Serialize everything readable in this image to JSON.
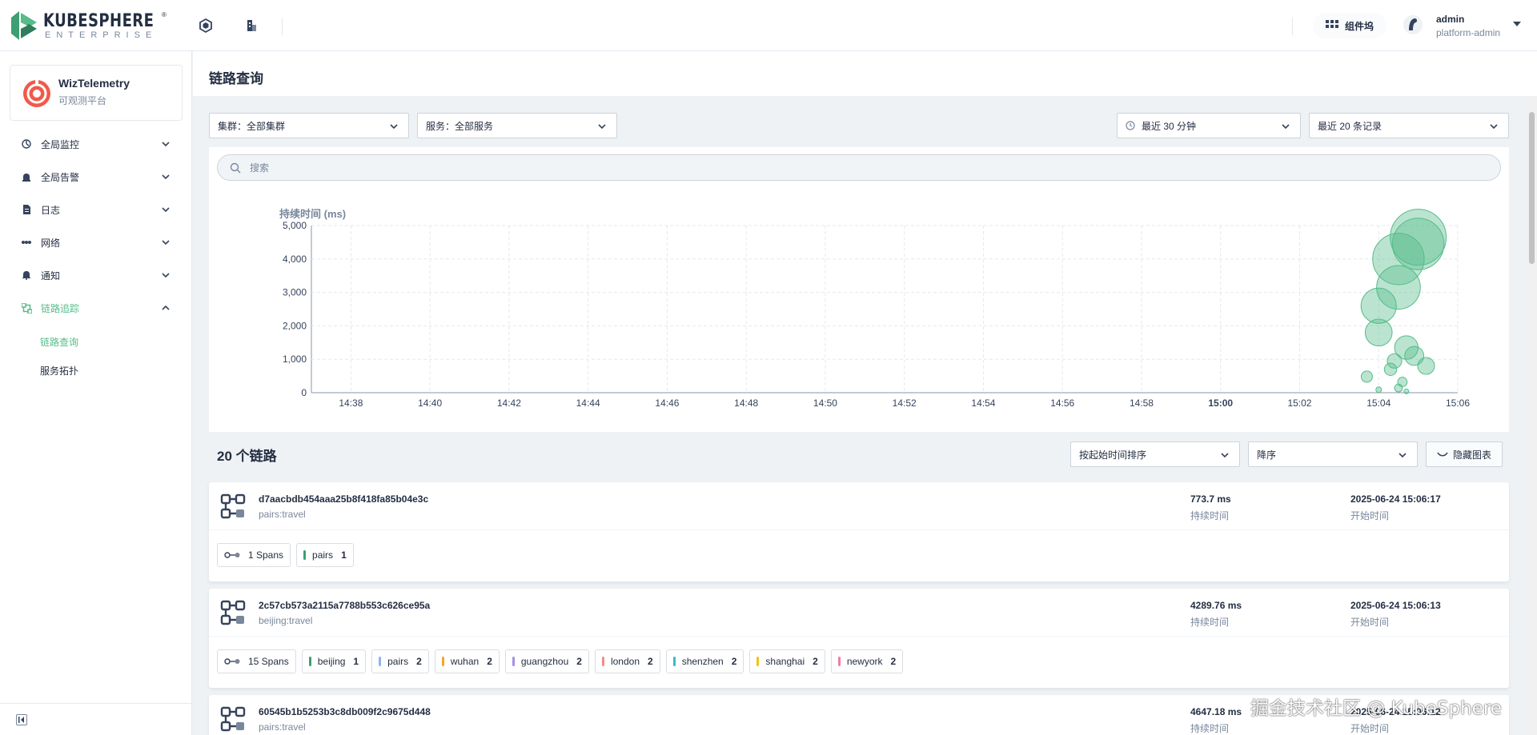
{
  "brand": {
    "name": "KUBESPHERE",
    "sub": "ENTERPRISE",
    "reg": "®"
  },
  "topbar": {
    "appstore_label": "组件坞",
    "user_name": "admin",
    "user_role": "platform-admin"
  },
  "app": {
    "title": "WizTelemetry",
    "desc": "可观测平台"
  },
  "nav": {
    "items": [
      {
        "label": "全局监控"
      },
      {
        "label": "全局告警"
      },
      {
        "label": "日志"
      },
      {
        "label": "网络"
      },
      {
        "label": "通知"
      },
      {
        "label": "链路追踪"
      }
    ],
    "sub": [
      {
        "label": "链路查询"
      },
      {
        "label": "服务拓扑"
      }
    ]
  },
  "page": {
    "title": "链路查询"
  },
  "filters": {
    "cluster": "集群：全部集群",
    "service": "服务：全部服务",
    "time_range": "最近 30 分钟",
    "limit": "最近 20 条记录"
  },
  "search": {
    "placeholder": "搜索"
  },
  "chart_data": {
    "type": "scatter",
    "ylabel": "持续时间 (ms)",
    "ylim": [
      0,
      5000
    ],
    "yticks": [
      "0",
      "1,000",
      "2,000",
      "3,000",
      "4,000",
      "5,000"
    ],
    "xticks": [
      "14:38",
      "14:40",
      "14:42",
      "14:44",
      "14:46",
      "14:48",
      "14:50",
      "14:52",
      "14:54",
      "14:56",
      "14:58",
      "15:00",
      "15:02",
      "15:04",
      "15:06"
    ],
    "grid": true,
    "color": "#55bc8a",
    "points": [
      {
        "t": 29.0,
        "y": 4650,
        "size": 1.0
      },
      {
        "t": 29.0,
        "y": 4450,
        "size": 0.92
      },
      {
        "t": 28.5,
        "y": 4000,
        "size": 0.92
      },
      {
        "t": 28.5,
        "y": 3150,
        "size": 0.78
      },
      {
        "t": 28.0,
        "y": 2600,
        "size": 0.63
      },
      {
        "t": 28.0,
        "y": 1800,
        "size": 0.48
      },
      {
        "t": 28.7,
        "y": 1350,
        "size": 0.42
      },
      {
        "t": 28.9,
        "y": 1100,
        "size": 0.34
      },
      {
        "t": 29.2,
        "y": 800,
        "size": 0.3
      },
      {
        "t": 28.4,
        "y": 950,
        "size": 0.26
      },
      {
        "t": 28.3,
        "y": 700,
        "size": 0.22
      },
      {
        "t": 27.7,
        "y": 480,
        "size": 0.2
      },
      {
        "t": 28.6,
        "y": 320,
        "size": 0.17
      },
      {
        "t": 28.5,
        "y": 140,
        "size": 0.14
      },
      {
        "t": 28.0,
        "y": 90,
        "size": 0.1
      },
      {
        "t": 28.7,
        "y": 40,
        "size": 0.08
      }
    ]
  },
  "list": {
    "title": "20 个链路",
    "sort_by": "按起始时间排序",
    "order": "降序",
    "hide_chart": "隐藏图表",
    "duration_label": "持续时间",
    "start_label": "开始时间"
  },
  "traces": [
    {
      "id": "d7aacbdb454aaa25b8f418fa85b04e3c",
      "service": "pairs:travel",
      "duration": "773.7 ms",
      "start": "2025-06-24 15:06:17",
      "spans": "1 Spans",
      "tags": [
        {
          "name": "pairs",
          "count": "1",
          "color": "#3d9f72"
        }
      ]
    },
    {
      "id": "2c57cb573a2115a7788b553c626ce95a",
      "service": "beijing:travel",
      "duration": "4289.76 ms",
      "start": "2025-06-24 15:06:13",
      "spans": "15 Spans",
      "tags": [
        {
          "name": "beijing",
          "count": "1",
          "color": "#3d9f72"
        },
        {
          "name": "pairs",
          "count": "2",
          "color": "#8fb4f0"
        },
        {
          "name": "wuhan",
          "count": "2",
          "color": "#f5a623"
        },
        {
          "name": "guangzhou",
          "count": "2",
          "color": "#a98ee8"
        },
        {
          "name": "london",
          "count": "2",
          "color": "#ef8c8c"
        },
        {
          "name": "shenzhen",
          "count": "2",
          "color": "#3db9c8"
        },
        {
          "name": "shanghai",
          "count": "2",
          "color": "#f2c218"
        },
        {
          "name": "newyork",
          "count": "2",
          "color": "#f27da8"
        }
      ]
    },
    {
      "id": "60545b1b5253b3c8db009f2c9675d448",
      "service": "pairs:travel",
      "duration": "4647.18 ms",
      "start": "2025-06-24 15:06:12",
      "spans": "",
      "tags": []
    }
  ],
  "watermark": "掘金技术社区 @ KubeSphere"
}
